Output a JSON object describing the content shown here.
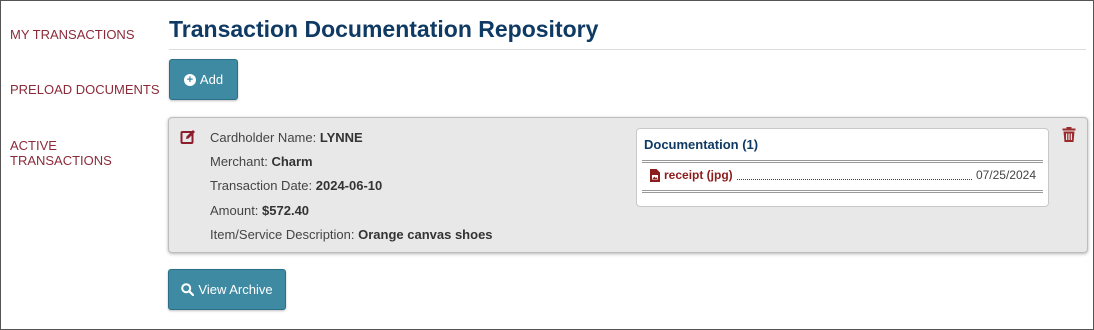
{
  "sidebar": {
    "items": [
      {
        "label": "MY TRANSACTIONS"
      },
      {
        "label": "PRELOAD DOCUMENTS"
      },
      {
        "label": "ACTIVE TRANSACTIONS"
      }
    ]
  },
  "page": {
    "title": "Transaction Documentation Repository"
  },
  "toolbar": {
    "add_label": "Add",
    "view_archive_label": "View Archive"
  },
  "transaction": {
    "cardholder_label": "Cardholder Name:",
    "cardholder_value": "LYNNE",
    "merchant_label": "Merchant:",
    "merchant_value": "Charm",
    "date_label": "Transaction Date:",
    "date_value": "2024-06-10",
    "amount_label": "Amount:",
    "amount_value": "$572.40",
    "description_label": "Item/Service Description:",
    "description_value": "Orange canvas shoes",
    "documentation": {
      "title": "Documentation (1)",
      "files": [
        {
          "name": "receipt (jpg)",
          "date": "07/25/2024"
        }
      ]
    }
  },
  "colors": {
    "nav_text": "#8b2b3a",
    "title": "#0f3a63",
    "button": "#3f8aa3",
    "card_bg": "#e8e8e8",
    "file_link": "#8b1d1d"
  },
  "icons": {
    "add": "plus-circle-icon",
    "view_archive": "search-icon",
    "edit": "edit-icon",
    "delete": "trash-icon",
    "file": "file-image-icon"
  }
}
